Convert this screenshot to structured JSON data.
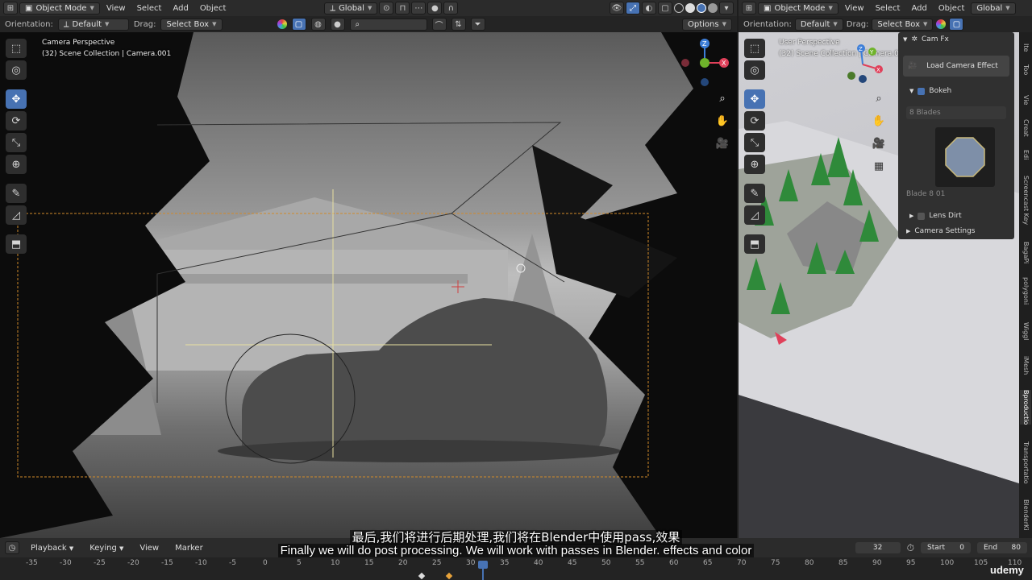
{
  "left_header": {
    "mode": "Object Mode",
    "menus": [
      "View",
      "Select",
      "Add",
      "Object"
    ],
    "transform": "Global"
  },
  "left_header2": {
    "orientation_label": "Orientation:",
    "orientation_value": "Default",
    "drag_label": "Drag:",
    "drag_value": "Select Box",
    "options": "Options"
  },
  "left_viewport": {
    "title_line1": "Camera Perspective",
    "title_line2": "(32) Scene Collection | Camera.001"
  },
  "right_header": {
    "mode": "Object Mode",
    "menus": [
      "View",
      "Select",
      "Add",
      "Object"
    ],
    "transform": "Global"
  },
  "right_header2": {
    "orientation_label": "Orientation:",
    "orientation_value": "Default",
    "drag_label": "Drag:",
    "drag_value": "Select Box"
  },
  "right_viewport": {
    "title_line1": "User Perspective",
    "title_line2": "(32) Scene Collection | Camera.001"
  },
  "gizmo": {
    "x": "X",
    "y": "Y",
    "z": "Z"
  },
  "npanel": {
    "section": "Cam Fx",
    "load_button": "Load Camera Effect",
    "bokeh": "Bokeh",
    "blades": "8 Blades",
    "blade_name": "Blade 8 01",
    "lens_dirt": "Lens Dirt",
    "camera_settings": "Camera Settings"
  },
  "side_tabs": [
    "Ite",
    "Too",
    "Vie",
    "Creat",
    "Edi",
    "Screencast Key",
    "BagaPi",
    "polygoni",
    "Wiggl",
    "iMesh",
    "Bproductio",
    "Transportatio",
    "BlenderKi"
  ],
  "timeline": {
    "menus": [
      "Playback",
      "Keying",
      "View",
      "Marker"
    ],
    "current_frame": "32",
    "start_label": "Start",
    "start_value": "0",
    "end_label": "End",
    "end_value": "80",
    "ticks": [
      "-35",
      "-30",
      "-25",
      "-20",
      "-15",
      "-10",
      "-5",
      "0",
      "5",
      "10",
      "15",
      "20",
      "25",
      "30",
      "35",
      "40",
      "45",
      "50",
      "55",
      "60",
      "65",
      "70",
      "75",
      "80",
      "85",
      "90",
      "95",
      "100",
      "105",
      "110"
    ]
  },
  "subtitles": {
    "zh": "最后,我们将进行后期处理,我们将在Blender中使用pass,效果",
    "en": "Finally we will do post processing. We will work with passes in Blender. effects and color"
  },
  "watermark": "udemy",
  "colors": {
    "accent": "#4772b3",
    "camera_frame": "#d08a2a",
    "x_axis": "#e0405a",
    "y_axis": "#6fb32b",
    "z_axis": "#3d7ed8"
  }
}
